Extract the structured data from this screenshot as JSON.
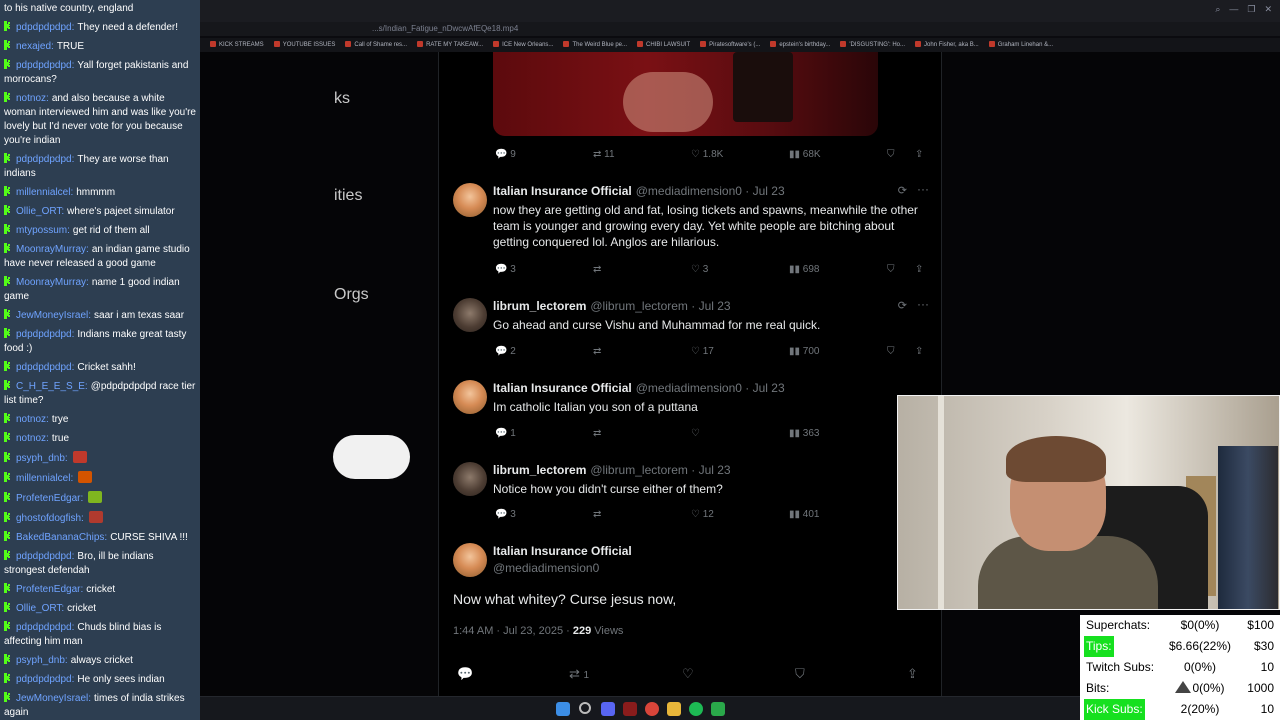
{
  "browser": {
    "url": "...s/Indian_Fatigue_nDwcwAfEQe18.mp4",
    "bookmarks": [
      "KICK STREAMS",
      "YOUTUBE ISSUES",
      "Call of Shame res...",
      "RATE MY TAKEAW...",
      "ICE New Orleans...",
      "The Weird Blue pe...",
      "CHIBI LAWSUIT",
      "Piratesoftware's (...",
      "epstein's birthday...",
      "'DISGUSTING': Ho...",
      "John Fisher, aka B...",
      "Graham Linehan &..."
    ]
  },
  "chat": [
    {
      "user": "",
      "text": "to his native country, england",
      "badge": false
    },
    {
      "user": "pdpdpdpdpd:",
      "text": "They need a defender!",
      "badge": true
    },
    {
      "user": "nexajed:",
      "text": "TRUE",
      "badge": true
    },
    {
      "user": "pdpdpdpdpd:",
      "text": "Yall forget pakistanis and morrocans?",
      "badge": true
    },
    {
      "user": "notnoz:",
      "text": "and also because a white woman interviewed him and was like you're lovely but I'd never vote for you because you're indian",
      "badge": true
    },
    {
      "user": "pdpdpdpdpd:",
      "text": "They are worse than indians",
      "badge": true
    },
    {
      "user": "millennialcel:",
      "text": "hmmmm",
      "badge": true
    },
    {
      "user": "Ollie_ORT:",
      "text": "where's pajeet simulator",
      "badge": true
    },
    {
      "user": "mtypossum:",
      "text": "get rid of them all",
      "badge": true
    },
    {
      "user": "MoonrayMurray:",
      "text": "an indian game studio have never released a good game",
      "badge": true
    },
    {
      "user": "MoonrayMurray:",
      "text": "name 1 good indian game",
      "badge": true
    },
    {
      "user": "JewMoneyIsrael:",
      "text": "saar i am texas saar",
      "badge": true
    },
    {
      "user": "pdpdpdpdpd:",
      "text": "Indians make great tasty food :)",
      "badge": true
    },
    {
      "user": "pdpdpdpdpd:",
      "text": "Cricket sahh!",
      "badge": true
    },
    {
      "user": "C_H_E_E_S_E:",
      "text": "@pdpdpdpdpd race tier list time?",
      "badge": true
    },
    {
      "user": "notnoz:",
      "text": "trye",
      "badge": true
    },
    {
      "user": "notnoz:",
      "text": "true",
      "badge": true
    },
    {
      "user": "psyph_dnb:",
      "text": "",
      "badge": true,
      "emote": "#c0392b"
    },
    {
      "user": "millennialcel:",
      "text": "",
      "badge": true,
      "emote": "#d35400"
    },
    {
      "user": "ProfetenEdgar:",
      "text": "",
      "badge": true,
      "emote": "#7fb61f"
    },
    {
      "user": "ghostofdogfish:",
      "text": "",
      "badge": true,
      "emote": "#b03a2e"
    },
    {
      "user": "BakedBananaChips:",
      "text": "CURSE SHIVA !!!",
      "badge": true
    },
    {
      "user": "pdpdpdpdpd:",
      "text": "Bro, ill be indians strongest defendah",
      "badge": true
    },
    {
      "user": "ProfetenEdgar:",
      "text": "cricket",
      "badge": true
    },
    {
      "user": "Ollie_ORT:",
      "text": "cricket",
      "badge": true
    },
    {
      "user": "pdpdpdpdpd:",
      "text": "Chuds blind bias is affecting him man",
      "badge": true
    },
    {
      "user": "psyph_dnb:",
      "text": "always cricket",
      "badge": true
    },
    {
      "user": "pdpdpdpdpd:",
      "text": "He only sees indian",
      "badge": true
    },
    {
      "user": "JewMoneyIsrael:",
      "text": "times of india strikes again",
      "badge": true
    }
  ],
  "sidebar_fragments": [
    "ks",
    "ities",
    "Orgs"
  ],
  "tweets": [
    {
      "name": "",
      "handle": "",
      "text": "",
      "stats": {
        "replies": "9",
        "retweets": "11",
        "likes": "1.8K",
        "views": "68K"
      }
    },
    {
      "name": "Italian Insurance Official",
      "handle": "@mediadimension0 · Jul 23",
      "text": "now they are getting old and fat, losing tickets and spawns, meanwhile the other team is younger and growing every day. Yet white people are bitching about getting conquered lol. Anglos are hilarious.",
      "stats": {
        "replies": "3",
        "retweets": "",
        "likes": "3",
        "views": "698"
      }
    },
    {
      "name": "librum_lectorem",
      "handle": "@librum_lectorem · Jul 23",
      "text": "Go ahead and curse Vishu and Muhammad for me real quick.",
      "stats": {
        "replies": "2",
        "retweets": "",
        "likes": "17",
        "views": "700"
      }
    },
    {
      "name": "Italian Insurance Official",
      "handle": "@mediadimension0 · Jul 23",
      "text": "Im catholic Italian you son of a puttana",
      "stats": {
        "replies": "1",
        "retweets": "",
        "likes": "",
        "views": "363"
      }
    },
    {
      "name": "librum_lectorem",
      "handle": "@librum_lectorem · Jul 23",
      "text": "Notice how you didn't curse either of them?",
      "stats": {
        "replies": "3",
        "retweets": "",
        "likes": "12",
        "views": "401"
      }
    }
  ],
  "main_tweet": {
    "name": "Italian Insurance Official",
    "handle": "@mediadimension0",
    "text": "Now what whitey? Curse jesus now,",
    "time": "1:44 AM · Jul 23, 2025 · ",
    "views_count": "229",
    "views_label": " Views",
    "retweets": "1"
  },
  "stats_overlay": [
    {
      "label": "Superchats:",
      "value": "$0(0%)",
      "goal": "$100",
      "highlight": false
    },
    {
      "label": "Tips:",
      "value": "$6.66(22%)",
      "goal": "$30",
      "highlight": true
    },
    {
      "label": "Twitch Subs:",
      "value": "0(0%)",
      "goal": "10",
      "highlight": false
    },
    {
      "label": "Bits:",
      "value": "0(0%)",
      "goal": "1000",
      "highlight": false
    },
    {
      "label": "Kick Subs:",
      "value": "2(20%)",
      "goal": "10",
      "highlight": true
    }
  ],
  "icons": {
    "reply": "reply-icon",
    "retweet": "retweet-icon",
    "like": "like-icon",
    "views": "views-icon",
    "bookmark": "bookmark-icon",
    "share": "share-icon",
    "more": "more-icon",
    "grok": "grok-icon"
  }
}
